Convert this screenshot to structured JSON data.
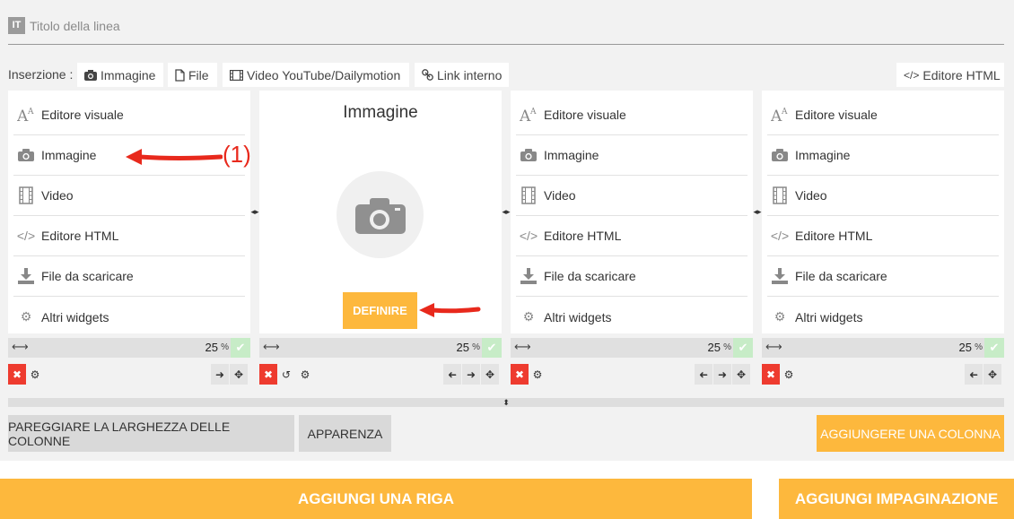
{
  "title_line": {
    "lang": "IT",
    "placeholder": "Titolo della linea"
  },
  "insertion": {
    "label": "Inserzione :",
    "buttons": [
      "Immagine",
      "File",
      "Video YouTube/Dailymotion",
      "Link interno"
    ],
    "html_editor": "Editore HTML"
  },
  "widgets": [
    "Editore visuale",
    "Immagine",
    "Video",
    "Editore HTML",
    "File da scaricare",
    "Altri widgets"
  ],
  "image_column": {
    "title": "Immagine",
    "define_label": "DEFINIRE"
  },
  "column_width": {
    "value": "25",
    "unit": "%"
  },
  "buttons": {
    "equalize": "PAREGGIARE LA LARGHEZZA DELLE COLONNE",
    "appearance": "APPARENZA",
    "add_column": "AGGIUNGERE UNA COLONNA",
    "add_row": "AGGIUNGI UNA RIGA",
    "add_layout": "AGGIUNGI IMPAGINAZIONE"
  },
  "annotation": {
    "label": "(1)"
  },
  "colors": {
    "accent": "#fdb83d",
    "delete": "#ee3b2f",
    "confirm": "#c7ecc7",
    "arrow": "#e8291c"
  }
}
